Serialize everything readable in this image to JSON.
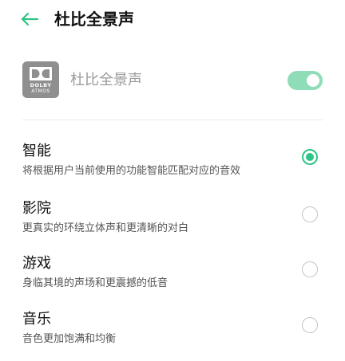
{
  "header": {
    "title": "杜比全景声",
    "back_icon": "arrow-left-icon",
    "accent_color": "#2fc486"
  },
  "master": {
    "label": "杜比全景声",
    "logo_word": "DOLBY",
    "logo_sub": "ATMOS",
    "toggle_on": true,
    "toggle_color": "#8fdcb8"
  },
  "options": [
    {
      "title": "智能",
      "description": "将根据用户当前使用的功能智能匹配对应的音效",
      "selected": true
    },
    {
      "title": "影院",
      "description": "更真实的环绕立体声和更清晰的对白",
      "selected": false
    },
    {
      "title": "游戏",
      "description": "身临其境的声场和更震撼的低音",
      "selected": false
    },
    {
      "title": "音乐",
      "description": "音色更加饱满和均衡",
      "selected": false
    }
  ]
}
